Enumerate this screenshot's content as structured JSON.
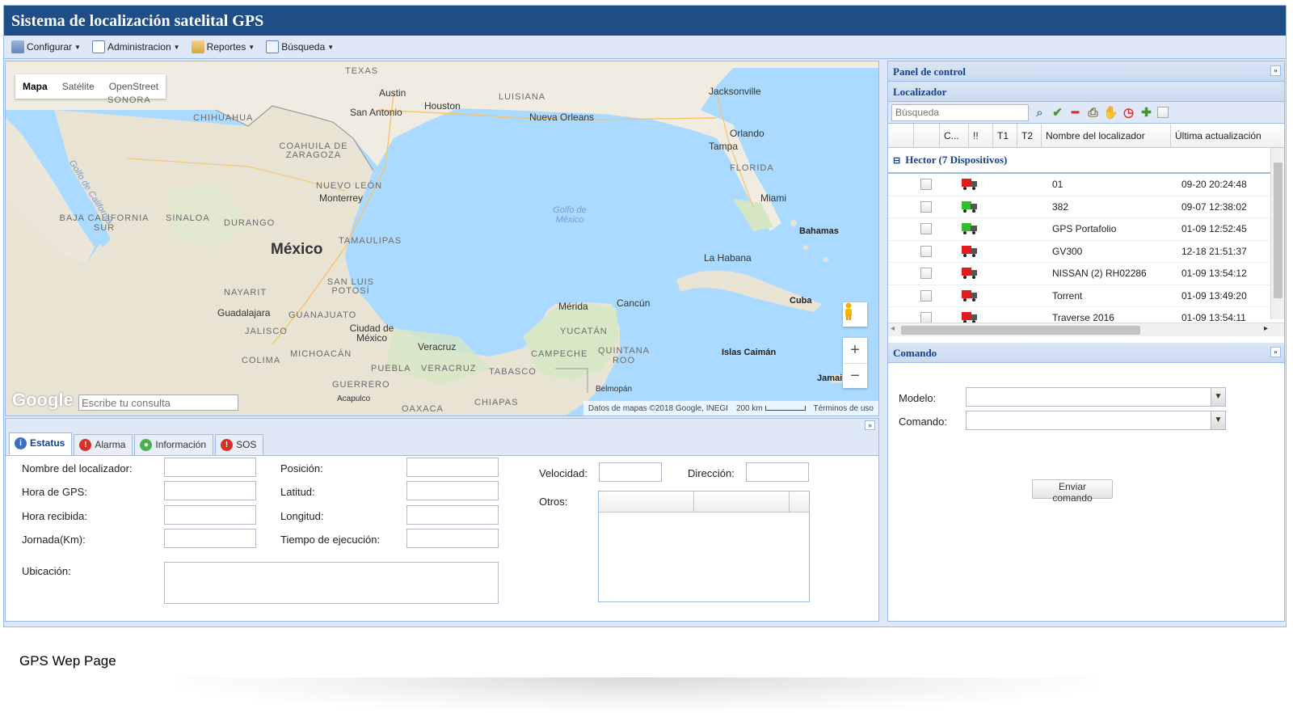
{
  "app": {
    "title": "Sistema de localización satelital GPS"
  },
  "menu": [
    {
      "label": "Configurar",
      "icon": "config-icon"
    },
    {
      "label": "Administracion",
      "icon": "edit-icon"
    },
    {
      "label": "Reportes",
      "icon": "report-icon"
    },
    {
      "label": "Búsqueda",
      "icon": "search-icon"
    }
  ],
  "map": {
    "types": [
      "Mapa",
      "Satélite",
      "OpenStreet"
    ],
    "active_type": "Mapa",
    "search_placeholder": "Escribe tu consulta",
    "logo": "Google",
    "attribution": "Datos de mapas ©2018 Google, INEGI",
    "scale": "200 km",
    "terms": "Términos de uso",
    "labels": {
      "texas": "TEXAS",
      "austin": "Austin",
      "houston": "Houston",
      "san_antonio": "San Antonio",
      "luisiana": "LUISIANA",
      "jacksonville": "Jacksonville",
      "nueva_orleans": "Nueva Orleans",
      "orlando": "Orlando",
      "tampa": "Tampa",
      "florida": "FLORIDA",
      "miami": "Miami",
      "bahamas": "Bahamas",
      "sonora": "SONORA",
      "chihuahua": "CHIHUAHUA",
      "coahuila": "COAHUILA DE ZARAGOZA",
      "nuevo_leon": "NUEVO LEÓN",
      "monterrey": "Monterrey",
      "golfo_california": "Golfo de California",
      "baja": "BAJA CALIFORNIA SUR",
      "sinaloa": "SINALOA",
      "durango": "DURANGO",
      "tamaulipas": "TAMAULIPAS",
      "mexico": "México",
      "golfo_mexico": "Golfo de México",
      "la_habana": "La Habana",
      "cuba": "Cuba",
      "nayarit": "NAYARIT",
      "san_luis": "SAN LUIS POTOSÍ",
      "guadalajara": "Guadalajara",
      "guanajuato": "GUANAJUATO",
      "jalisco": "JALISCO",
      "cdmx": "Ciudad de México",
      "merida": "Mérida",
      "cancun": "Cancún",
      "yucatan": "YUCATÁN",
      "veracruz_city": "Veracruz",
      "campeche": "CAMPECHE",
      "quintana_roo": "QUINTANA ROO",
      "islas_caiman": "Islas Caimán",
      "colima": "COLIMA",
      "michoacan": "MICHOACÁN",
      "puebla": "PUEBLA",
      "veracruz": "VERACRUZ",
      "tabasco": "TABASCO",
      "jamaica": "Jamai",
      "guerrero": "GUERRERO",
      "acapulco": "Acapulco",
      "oaxaca": "OAXACA",
      "chiapas": "CHIAPAS",
      "belmopan": "Belmopán"
    }
  },
  "status": {
    "tabs": [
      {
        "label": "Estatus",
        "color": "#3a6fc4",
        "glyph": "i"
      },
      {
        "label": "Alarma",
        "color": "#d93025",
        "glyph": "!"
      },
      {
        "label": "Información",
        "color": "#4caf50",
        "glyph": "●"
      },
      {
        "label": "SOS",
        "color": "#d93025",
        "glyph": "!"
      }
    ],
    "fields": {
      "nombre": "Nombre del localizador:",
      "hora_gps": "Hora de GPS:",
      "hora_recibida": "Hora recibida:",
      "jornada": "Jornada(Km):",
      "ubicacion": "Ubicación:",
      "posicion": "Posición:",
      "latitud": "Latitud:",
      "longitud": "Longitud:",
      "tiempo": "Tiempo de ejecución:",
      "velocidad": "Velocidad:",
      "direccion": "Dirección:",
      "otros": "Otros:"
    }
  },
  "panel": {
    "title": "Panel de control",
    "localizador_title": "Localizador",
    "search_placeholder": "Búsqueda",
    "columns": [
      "C...",
      "!!",
      "T1",
      "T2",
      "Nombre del localizador",
      "Última actualización"
    ],
    "group": "Hector (7 Dispositivos)",
    "devices": [
      {
        "name": "01",
        "updated": "09-20 20:24:48",
        "status": "red"
      },
      {
        "name": "382",
        "updated": "09-07 12:38:02",
        "status": "green"
      },
      {
        "name": "GPS Portafolio",
        "updated": "01-09 12:52:45",
        "status": "green"
      },
      {
        "name": "GV300",
        "updated": "12-18 21:51:37",
        "status": "red"
      },
      {
        "name": "NISSAN (2) RH02286",
        "updated": "01-09 13:54:12",
        "status": "red"
      },
      {
        "name": "Torrent",
        "updated": "01-09 13:49:20",
        "status": "red"
      },
      {
        "name": "Traverse 2016",
        "updated": "01-09 13:54:11",
        "status": "red"
      }
    ],
    "comando_title": "Comando",
    "modelo_label": "Modelo:",
    "comando_label": "Comando:",
    "send_label": "Enviar comando"
  },
  "caption": "GPS Wep Page"
}
